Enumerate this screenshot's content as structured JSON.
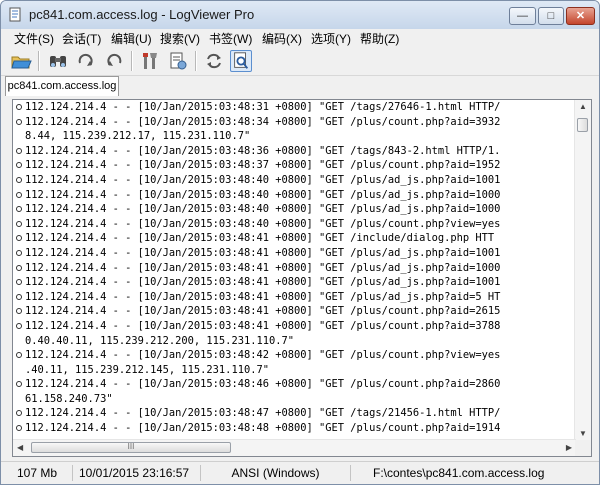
{
  "window": {
    "title": "pc841.com.access.log - LogViewer Pro",
    "min_label": "—",
    "max_label": "□",
    "close_label": "✕"
  },
  "menu": [
    "文件(S)",
    "会话(T)",
    "编辑(U)",
    "搜索(V)",
    "书签(W)",
    "编码(X)",
    "选项(Y)",
    "帮助(Z)"
  ],
  "toolbar": {
    "icons": [
      "open-folder-icon",
      "binoculars-icon",
      "redo-arrow-icon",
      "undo-arrow-icon",
      "tools-icon",
      "document-settings-icon",
      "refresh-icon",
      "document-search-icon"
    ]
  },
  "tab": {
    "label": "pc841.com.access.log"
  },
  "log_lines": [
    {
      "marker": true,
      "text": "112.124.214.4 - - [10/Jan/2015:03:48:31 +0800] \"GET /tags/27646-1.html HTTP/"
    },
    {
      "marker": true,
      "text": "112.124.214.4 - - [10/Jan/2015:03:48:34 +0800] \"GET /plus/count.php?aid=3932"
    },
    {
      "marker": false,
      "text": "8.44, 115.239.212.17, 115.231.110.7\""
    },
    {
      "marker": true,
      "text": "112.124.214.4 - - [10/Jan/2015:03:48:36 +0800] \"GET /tags/843-2.html HTTP/1."
    },
    {
      "marker": true,
      "text": "112.124.214.4 - - [10/Jan/2015:03:48:37 +0800] \"GET /plus/count.php?aid=1952"
    },
    {
      "marker": true,
      "text": "112.124.214.4 - - [10/Jan/2015:03:48:40 +0800] \"GET /plus/ad_js.php?aid=1001"
    },
    {
      "marker": true,
      "text": "112.124.214.4 - - [10/Jan/2015:03:48:40 +0800] \"GET /plus/ad_js.php?aid=1000"
    },
    {
      "marker": true,
      "text": "112.124.214.4 - - [10/Jan/2015:03:48:40 +0800] \"GET /plus/ad_js.php?aid=1000"
    },
    {
      "marker": true,
      "text": "112.124.214.4 - - [10/Jan/2015:03:48:40 +0800] \"GET /plus/count.php?view=yes"
    },
    {
      "marker": true,
      "text": "112.124.214.4 - - [10/Jan/2015:03:48:41 +0800] \"GET /include/dialog.php HTT"
    },
    {
      "marker": true,
      "text": "112.124.214.4 - - [10/Jan/2015:03:48:41 +0800] \"GET /plus/ad_js.php?aid=1001"
    },
    {
      "marker": true,
      "text": "112.124.214.4 - - [10/Jan/2015:03:48:41 +0800] \"GET /plus/ad_js.php?aid=1000"
    },
    {
      "marker": true,
      "text": "112.124.214.4 - - [10/Jan/2015:03:48:41 +0800] \"GET /plus/ad_js.php?aid=1001"
    },
    {
      "marker": true,
      "text": "112.124.214.4 - - [10/Jan/2015:03:48:41 +0800] \"GET /plus/ad_js.php?aid=5 HT"
    },
    {
      "marker": true,
      "text": "112.124.214.4 - - [10/Jan/2015:03:48:41 +0800] \"GET /plus/count.php?aid=2615"
    },
    {
      "marker": true,
      "text": "112.124.214.4 - - [10/Jan/2015:03:48:41 +0800] \"GET /plus/count.php?aid=3788"
    },
    {
      "marker": false,
      "text": "0.40.40.11, 115.239.212.200, 115.231.110.7\""
    },
    {
      "marker": true,
      "text": "112.124.214.4 - - [10/Jan/2015:03:48:42 +0800] \"GET /plus/count.php?view=yes"
    },
    {
      "marker": false,
      "text": ".40.11, 115.239.212.145, 115.231.110.7\""
    },
    {
      "marker": true,
      "text": "112.124.214.4 - - [10/Jan/2015:03:48:46 +0800] \"GET /plus/count.php?aid=2860"
    },
    {
      "marker": false,
      "text": "61.158.240.73\""
    },
    {
      "marker": true,
      "text": "112.124.214.4 - - [10/Jan/2015:03:48:47 +0800] \"GET /tags/21456-1.html HTTP/"
    },
    {
      "marker": true,
      "text": "112.124.214.4 - - [10/Jan/2015:03:48:48 +0800] \"GET /plus/count.php?aid=1914"
    }
  ],
  "scroll": {
    "h_thumb_label": "III"
  },
  "status": {
    "size": "107 Mb",
    "datetime": "10/01/2015 23:16:57",
    "encoding": "ANSI (Windows)",
    "path": "F:\\contes\\pc841.com.access.log"
  }
}
